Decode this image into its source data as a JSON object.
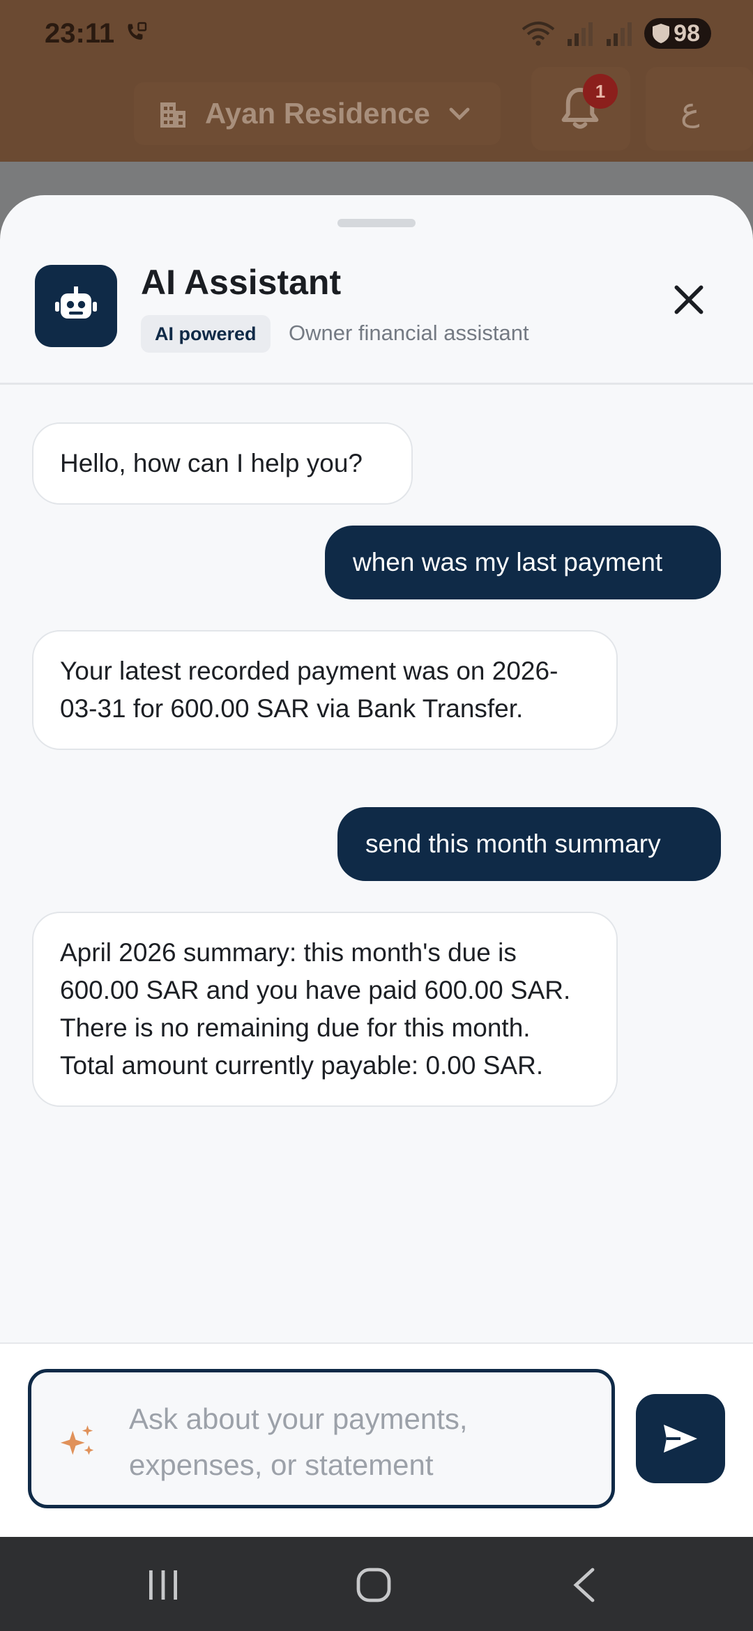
{
  "status_bar": {
    "time": "23:11",
    "battery": "98"
  },
  "app_bar": {
    "property_name": "Ayan Residence",
    "notification_count": "1",
    "language_toggle": "ع"
  },
  "sheet": {
    "title": "AI Assistant",
    "badge": "AI powered",
    "subtitle": "Owner financial assistant"
  },
  "messages": [
    {
      "role": "bot",
      "text": "Hello, how can I help you?"
    },
    {
      "role": "user",
      "text": "when was my last payment"
    },
    {
      "role": "bot",
      "text": "Your latest recorded payment was on 2026-03-31 for 600.00 SAR via Bank Transfer."
    },
    {
      "role": "user",
      "text": "send this month summary"
    },
    {
      "role": "bot",
      "text": "April 2026 summary: this month's due is 600.00 SAR and you have paid 600.00 SAR. There is no remaining due for this month. Total amount currently payable: 0.00 SAR."
    }
  ],
  "composer": {
    "value": "",
    "placeholder": "Ask about your payments, expenses, or statement"
  },
  "colors": {
    "brand_navy": "#0f2a47",
    "accent_sparkle": "#e0915a",
    "badge_red": "#8b1f1c"
  },
  "icons": {
    "building": "building-icon",
    "chevron": "chevron-down-icon",
    "bell": "bell-icon",
    "robot": "robot-icon",
    "close": "close-icon",
    "sparkle": "sparkle-icon",
    "send": "send-icon",
    "nav_recents": "recents-icon",
    "nav_home": "home-icon",
    "nav_back": "back-icon"
  }
}
